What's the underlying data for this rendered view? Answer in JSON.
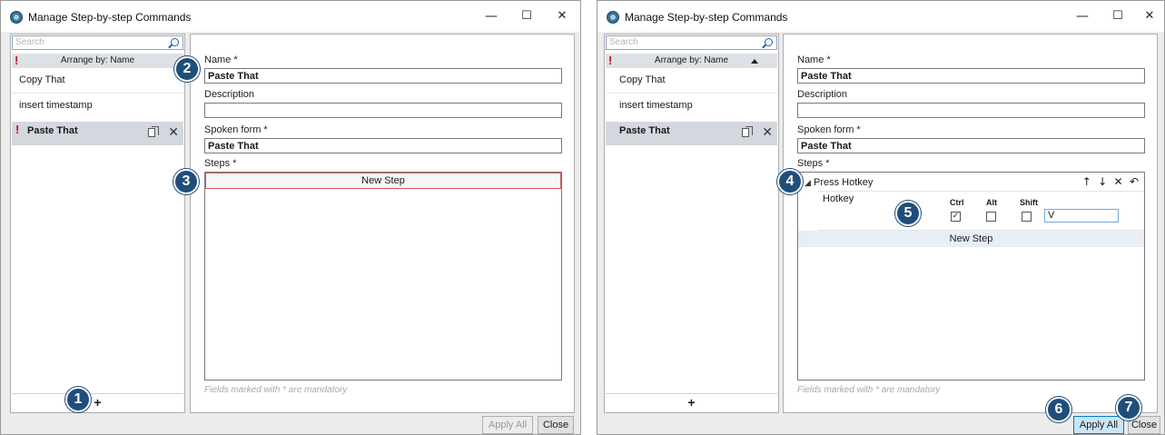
{
  "window_title": "Manage Step-by-step Commands",
  "window_controls": {
    "minimize": "—",
    "maximize": "☐",
    "close": "✕"
  },
  "search": {
    "placeholder": "Search"
  },
  "arrange_label": "Arrange by: Name",
  "exclamation": "!",
  "commands": [
    "Copy That",
    "insert timestamp",
    "Paste That"
  ],
  "add_label": "+",
  "duplicate_icon": "duplicate-icon",
  "delete_label": "✕",
  "form": {
    "name_label": "Name *",
    "name_value": "Paste That",
    "description_label": "Description",
    "description_value": "",
    "spoken_label": "Spoken form *",
    "spoken_value": "Paste That",
    "steps_label": "Steps *",
    "new_step": "New Step",
    "footer_note": "Fields marked with * are mandatory"
  },
  "step": {
    "expand_glyph": "◢",
    "title": "Press Hotkey",
    "tools": [
      "↑",
      "↓",
      "✕",
      "↶"
    ],
    "hotkey_label": "Hotkey",
    "modifiers": [
      "Ctrl",
      "Alt",
      "Shift"
    ],
    "modifiers_checked": [
      true,
      false,
      false
    ],
    "check_glyph": "✓",
    "key_value": "V"
  },
  "buttons": {
    "apply_all": "Apply All",
    "close": "Close"
  },
  "badges": [
    "1",
    "2",
    "3",
    "4",
    "5",
    "6",
    "7"
  ],
  "colors": {
    "badge": "#1f4e79",
    "selected_row": "#d3d7de",
    "required": "#d0021b",
    "new_step_border": "#d9534f"
  }
}
